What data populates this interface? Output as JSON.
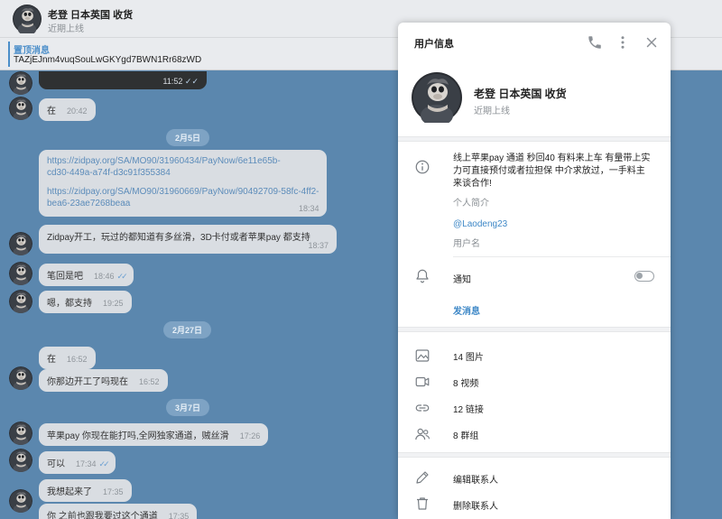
{
  "chat": {
    "title": "老登 日本英国 收货",
    "status": "近期上线",
    "pinned": {
      "title": "置顶消息",
      "text": "TAZjEJnm4vuqSouLwGKYgd7BWN1Rr68zWD"
    },
    "image_time": "11:52",
    "messages": [
      {
        "text": "在",
        "time": "20:42"
      },
      {
        "link1": "https://zidpay.org/SA/MO90/31960434/PayNow/6e11e65b-",
        "link1b": "cd30-449a-a74f-d3c91f355384",
        "link2": "https://zidpay.org/SA/MO90/31960669/PayNow/90492709-58fc-4ff2-",
        "link2b": "bea6-23ae7268beaa",
        "time": "18:34"
      },
      {
        "text": "Zidpay开工，玩过的都知道有多丝滑，3D卡付或者苹果pay 都支持",
        "time": "18:37"
      },
      {
        "text": "笔回是吧",
        "time": "18:46"
      },
      {
        "text": "嗯，都支持",
        "time": "19:25"
      },
      {
        "text": "在",
        "time": "16:52"
      },
      {
        "text": "你那边开工了吗现在",
        "time": "16:52"
      },
      {
        "text": "苹果pay 你现在能打吗,全网独家通道，贼丝滑",
        "time": "17:26"
      },
      {
        "text": "可以",
        "time": "17:34"
      },
      {
        "text": "我想起来了",
        "time": "17:35"
      },
      {
        "text": "你 之前也跟我要过这个通道",
        "time": "17:35"
      }
    ],
    "dates": [
      "2月5日",
      "2月27日",
      "3月7日"
    ]
  },
  "panel": {
    "title": "用户信息",
    "name": "老登 日本英国 收货",
    "status": "近期上线",
    "bio_line1": "线上苹果pay 通道 秒回40 有料来上车 有量带上实",
    "bio_line2": "力可直接预付或者拉担保 中介求放过，一手料主",
    "bio_line3": "来谈合作!",
    "bio_label": "个人简介",
    "username": "@Laodeng23",
    "username_label": "用户名",
    "notify_label": "通知",
    "notify_on": false,
    "send_message": "发消息",
    "media": [
      {
        "label": "14 图片",
        "icon": "image-icon"
      },
      {
        "label": "8 视频",
        "icon": "video-icon"
      },
      {
        "label": "12 链接",
        "icon": "link-icon"
      },
      {
        "label": "8 群组",
        "icon": "group-icon"
      }
    ],
    "actions": [
      {
        "label": "编辑联系人",
        "icon": "pencil-icon"
      },
      {
        "label": "删除联系人",
        "icon": "trash-icon"
      }
    ]
  },
  "colors": {
    "accent": "#3e88c7",
    "chat_bg": "#5b87ae",
    "bubble": "#d9dde2"
  }
}
